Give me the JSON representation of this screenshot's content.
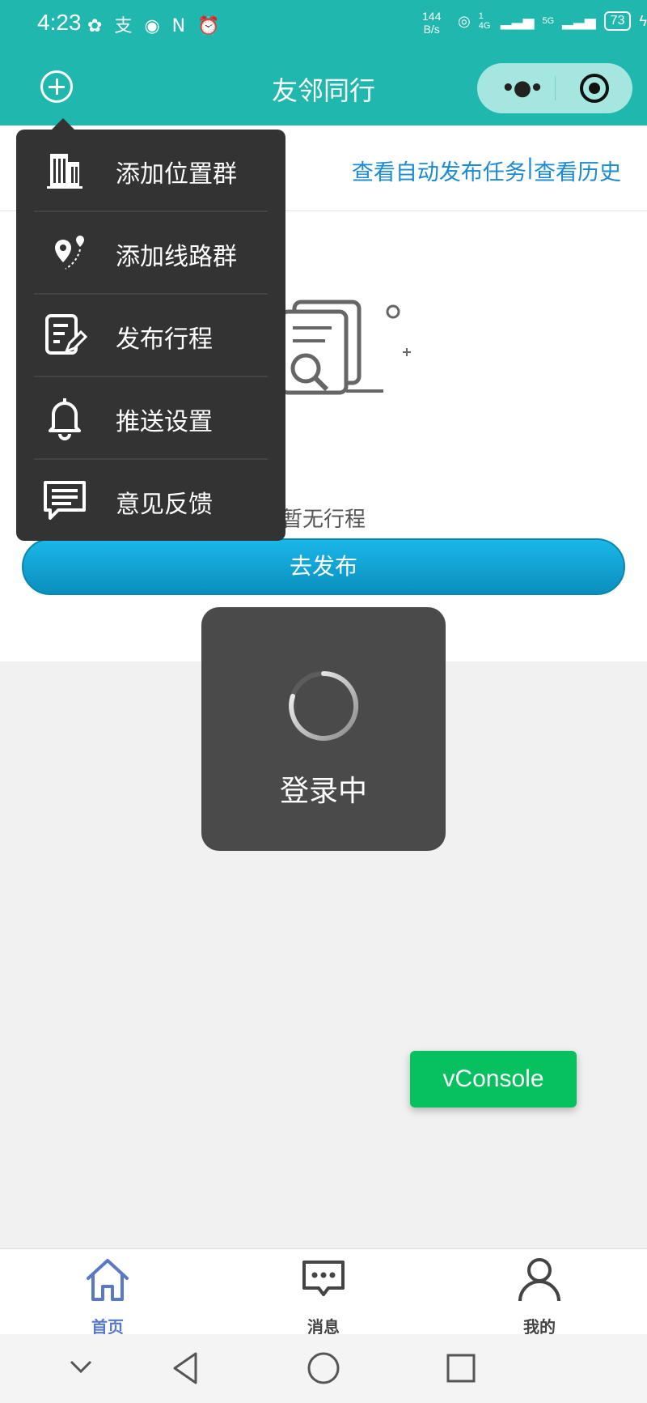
{
  "status_bar": {
    "time": "4:23",
    "left_icons": [
      "wechat-icon",
      "alipay-icon",
      "eye-icon",
      "nfc-icon",
      "alarm-icon"
    ],
    "net_speed_value": "144",
    "net_speed_unit": "B/s",
    "signal_1": "1 4G",
    "signal_2": "5G",
    "battery": "73"
  },
  "nav": {
    "title": "友邻同行",
    "more_symbol": "•●•"
  },
  "top_links": {
    "auto_tasks": "查看自动发布任务",
    "separator": "|",
    "history": "查看历史"
  },
  "menu": {
    "items": [
      {
        "label": "添加位置群",
        "icon": "building-icon"
      },
      {
        "label": "添加线路群",
        "icon": "route-pin-icon"
      },
      {
        "label": "发布行程",
        "icon": "edit-document-icon"
      },
      {
        "label": "推送设置",
        "icon": "bell-icon"
      },
      {
        "label": "意见反馈",
        "icon": "feedback-chat-icon"
      }
    ]
  },
  "empty_state": {
    "text": "暂无行程",
    "button": "去发布"
  },
  "toast": {
    "text": "登录中"
  },
  "vconsole": {
    "label": "vConsole"
  },
  "tab_bar": {
    "tabs": [
      {
        "label": "首页",
        "icon": "home-icon",
        "active": true
      },
      {
        "label": "消息",
        "icon": "message-icon",
        "active": false
      },
      {
        "label": "我的",
        "icon": "user-icon",
        "active": false
      }
    ]
  },
  "colors": {
    "brand": "#20b8ae",
    "link": "#1a8ad2",
    "button": "#0fa6d8",
    "vconsole": "#07c160",
    "tab_active": "#5a78c8"
  }
}
